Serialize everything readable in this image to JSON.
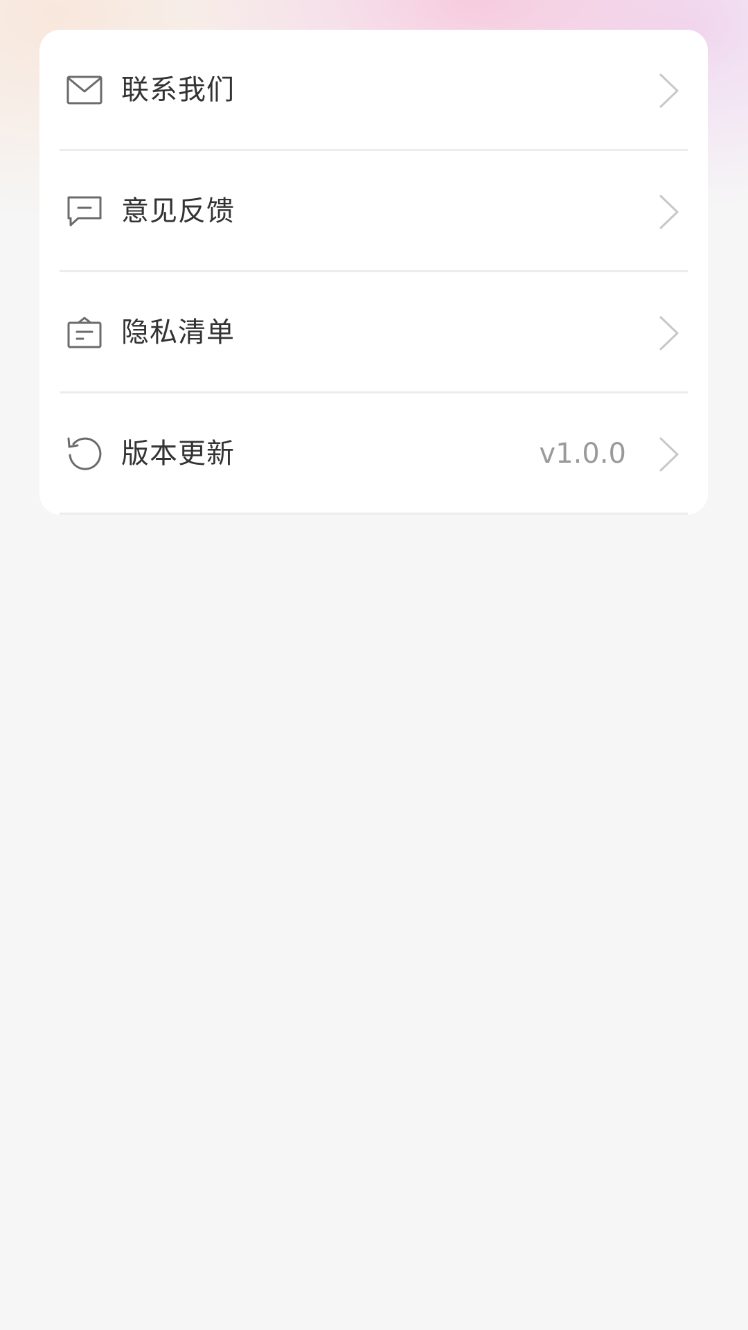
{
  "colors": {
    "card_bg": "#ffffff",
    "page_bg": "#f6f6f6",
    "label": "#333333",
    "secondary": "#9a9a9a",
    "icon": "#6b6b6b",
    "chevron": "#c8c8c8",
    "divider": "#ececec"
  },
  "menu": {
    "items": [
      {
        "icon": "mail-icon",
        "label": "联系我们",
        "value": ""
      },
      {
        "icon": "feedback-message-icon",
        "label": "意见反馈",
        "value": ""
      },
      {
        "icon": "privacy-list-icon",
        "label": "隐私清单",
        "value": ""
      },
      {
        "icon": "refresh-update-icon",
        "label": "版本更新",
        "value": "v1.0.0"
      }
    ]
  }
}
